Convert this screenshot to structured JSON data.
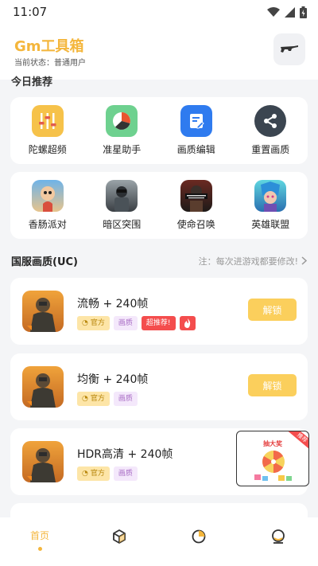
{
  "status_bar": {
    "time": "11:07"
  },
  "header": {
    "title": "Gm工具箱",
    "status": "当前状态：普通用户"
  },
  "today": {
    "title": "今日推荐"
  },
  "tools": [
    {
      "label": "陀螺超频",
      "icon": "gyro-equalizer-icon",
      "color": "#f6c24a"
    },
    {
      "label": "准星助手",
      "icon": "crosshair-pie-icon",
      "color": "#6ed18f"
    },
    {
      "label": "画质编辑",
      "icon": "quality-edit-icon",
      "color": "#2f7bef"
    },
    {
      "label": "重置画质",
      "icon": "reset-share-icon",
      "color": "#3b4550"
    }
  ],
  "games": [
    {
      "label": "香肠派对",
      "icon": "sausage-party-icon"
    },
    {
      "label": "暗区突围",
      "icon": "arena-breakout-icon"
    },
    {
      "label": "使命召唤",
      "icon": "call-of-duty-icon"
    },
    {
      "label": "英雄联盟",
      "icon": "league-of-legends-icon"
    }
  ],
  "section": {
    "title": "国服画质(UC)",
    "note": "注：每次进游戏都要修改!"
  },
  "presets": [
    {
      "name": "流畅 + 240帧",
      "tags": [
        "官方",
        "画质",
        "超推荐!"
      ],
      "hot": true,
      "button": "解锁"
    },
    {
      "name": "均衡 + 240帧",
      "tags": [
        "官方",
        "画质"
      ],
      "hot": false,
      "button": "解锁"
    },
    {
      "name": "HDR高清 + 240帧",
      "tags": [
        "官方",
        "画质"
      ],
      "hot": false,
      "button": ""
    }
  ],
  "ad": {
    "title": "抽大奖",
    "corner": "推荐"
  },
  "nav": [
    {
      "label": "首页",
      "icon": "home-icon",
      "active": true
    },
    {
      "label": "",
      "icon": "cube-icon",
      "active": false
    },
    {
      "label": "",
      "icon": "chart-ring-icon",
      "active": false
    },
    {
      "label": "",
      "icon": "profile-icon",
      "active": false
    }
  ],
  "colors": {
    "accent": "#f4b63c",
    "button": "#fbcf5c",
    "hot": "#f44d4d"
  }
}
